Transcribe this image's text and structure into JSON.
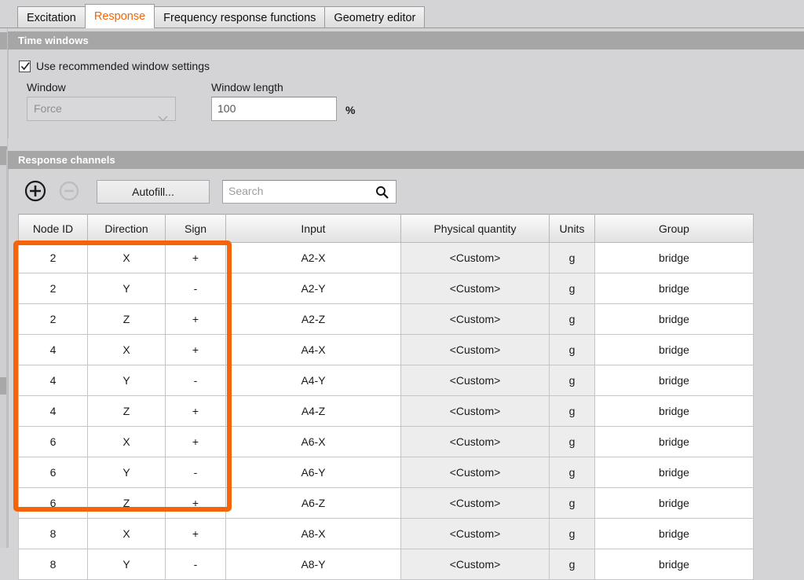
{
  "tabs": [
    {
      "label": "Excitation",
      "active": false
    },
    {
      "label": "Response",
      "active": true
    },
    {
      "label": "Frequency response functions",
      "active": false
    },
    {
      "label": "Geometry editor",
      "active": false
    }
  ],
  "time_windows": {
    "section_title": "Time windows",
    "use_recommended": {
      "label": "Use recommended window settings",
      "checked": true
    },
    "window": {
      "label": "Window",
      "value": "Force",
      "disabled": true
    },
    "window_length": {
      "label": "Window length",
      "value": "100",
      "unit": "%"
    }
  },
  "response_channels": {
    "section_title": "Response channels",
    "toolbar": {
      "add_label": "+",
      "remove_label": "−",
      "autofill_label": "Autofill...",
      "search_placeholder": "Search"
    },
    "columns": [
      "Node ID",
      "Direction",
      "Sign",
      "Input",
      "Physical quantity",
      "Units",
      "Group"
    ],
    "rows": [
      {
        "node_id": "2",
        "direction": "X",
        "sign": "+",
        "input": "A2-X",
        "physical_quantity": "<Custom>",
        "units": "g",
        "group": "bridge"
      },
      {
        "node_id": "2",
        "direction": "Y",
        "sign": "-",
        "input": "A2-Y",
        "physical_quantity": "<Custom>",
        "units": "g",
        "group": "bridge"
      },
      {
        "node_id": "2",
        "direction": "Z",
        "sign": "+",
        "input": "A2-Z",
        "physical_quantity": "<Custom>",
        "units": "g",
        "group": "bridge"
      },
      {
        "node_id": "4",
        "direction": "X",
        "sign": "+",
        "input": "A4-X",
        "physical_quantity": "<Custom>",
        "units": "g",
        "group": "bridge"
      },
      {
        "node_id": "4",
        "direction": "Y",
        "sign": "-",
        "input": "A4-Y",
        "physical_quantity": "<Custom>",
        "units": "g",
        "group": "bridge"
      },
      {
        "node_id": "4",
        "direction": "Z",
        "sign": "+",
        "input": "A4-Z",
        "physical_quantity": "<Custom>",
        "units": "g",
        "group": "bridge"
      },
      {
        "node_id": "6",
        "direction": "X",
        "sign": "+",
        "input": "A6-X",
        "physical_quantity": "<Custom>",
        "units": "g",
        "group": "bridge"
      },
      {
        "node_id": "6",
        "direction": "Y",
        "sign": "-",
        "input": "A6-Y",
        "physical_quantity": "<Custom>",
        "units": "g",
        "group": "bridge"
      },
      {
        "node_id": "6",
        "direction": "Z",
        "sign": "+",
        "input": "A6-Z",
        "physical_quantity": "<Custom>",
        "units": "g",
        "group": "bridge"
      },
      {
        "node_id": "8",
        "direction": "X",
        "sign": "+",
        "input": "A8-X",
        "physical_quantity": "<Custom>",
        "units": "g",
        "group": "bridge"
      },
      {
        "node_id": "8",
        "direction": "Y",
        "sign": "-",
        "input": "A8-Y",
        "physical_quantity": "<Custom>",
        "units": "g",
        "group": "bridge"
      }
    ]
  },
  "annotation": {
    "highlight_color": "#f4640a",
    "highlight_covers_columns": [
      "Node ID",
      "Direction",
      "Sign"
    ],
    "highlight_covers_rows": 9
  },
  "colors": {
    "accent": "#f4640a",
    "section_header_bg": "#a6a6a6",
    "page_bg": "#d4d4d6",
    "row_shade": "#ededed"
  }
}
